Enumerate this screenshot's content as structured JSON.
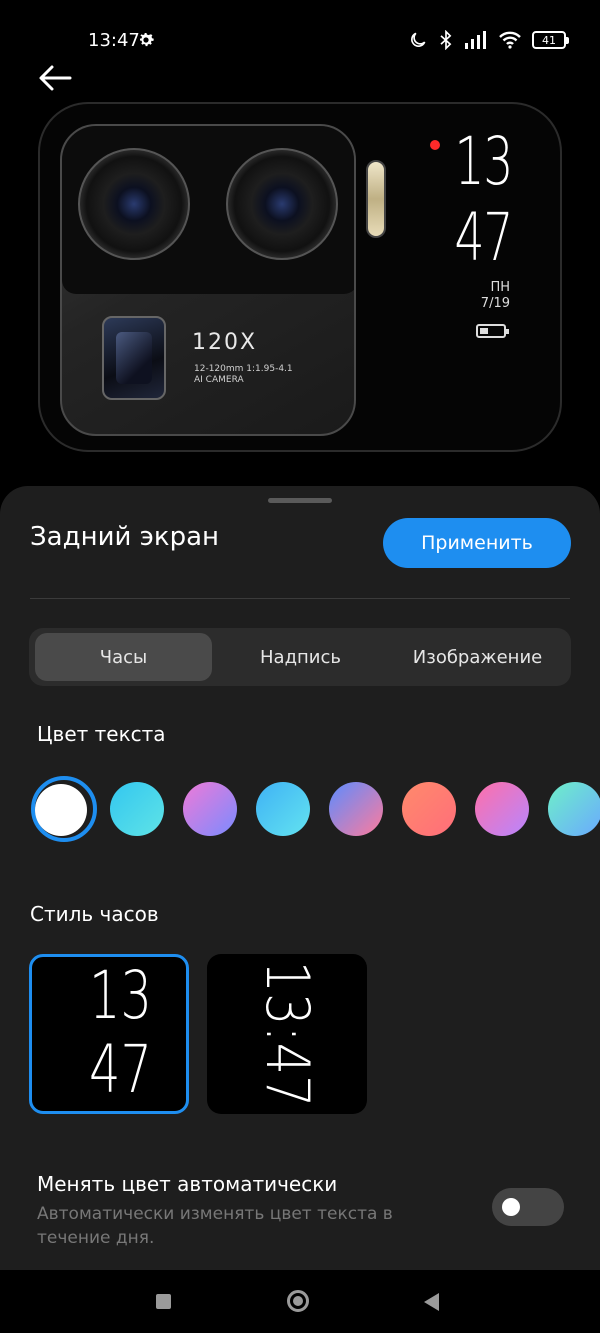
{
  "status_bar": {
    "time": "13:47",
    "battery": "41",
    "icons": [
      "gear-icon",
      "moon-icon",
      "bluetooth-icon",
      "signal-icon",
      "wifi-icon",
      "battery-icon"
    ]
  },
  "preview": {
    "camera_zoom": "120X",
    "camera_spec_line1": "12-120mm 1:1.95-4.1",
    "camera_spec_line2": "AI CAMERA",
    "hour": "13",
    "minute": "47",
    "day": "ПН",
    "date": "7/19"
  },
  "sheet": {
    "title": "Задний экран",
    "apply_label": "Применить",
    "tabs": [
      {
        "label": "Часы",
        "selected": true
      },
      {
        "label": "Надпись",
        "selected": false
      },
      {
        "label": "Изображение",
        "selected": false
      }
    ],
    "text_color_label": "Цвет текста",
    "swatches": [
      {
        "name": "white",
        "colors": [
          "#ffffff",
          "#ffffff"
        ],
        "selected": true
      },
      {
        "name": "cyan",
        "colors": [
          "#33c7f0",
          "#5fe3e6"
        ]
      },
      {
        "name": "purple-pink",
        "colors": [
          "#ef7ad7",
          "#7a8bff"
        ]
      },
      {
        "name": "blue",
        "colors": [
          "#3fb2f5",
          "#63e3f0"
        ]
      },
      {
        "name": "blue-pink",
        "colors": [
          "#5c8cff",
          "#ff7b9c"
        ]
      },
      {
        "name": "coral",
        "colors": [
          "#ff8a6b",
          "#ff6e7a"
        ]
      },
      {
        "name": "pink-violet",
        "colors": [
          "#ff6fa8",
          "#b786ff"
        ]
      },
      {
        "name": "teal-blue",
        "colors": [
          "#6ef0c8",
          "#6aa9ff"
        ]
      }
    ],
    "clock_style_label": "Стиль часов",
    "clock_styles": [
      {
        "hour": "13",
        "minute": "47",
        "selected": true
      },
      {
        "time": "13:47",
        "selected": false
      }
    ],
    "auto_color_title": "Менять цвет автоматически",
    "auto_color_desc": "Автоматически изменять цвет текста в течение дня.",
    "auto_color_enabled": false
  },
  "colors": {
    "accent": "#1e8ef0",
    "sheet_bg": "#1e1e1e",
    "secondary_text": "#777777"
  }
}
